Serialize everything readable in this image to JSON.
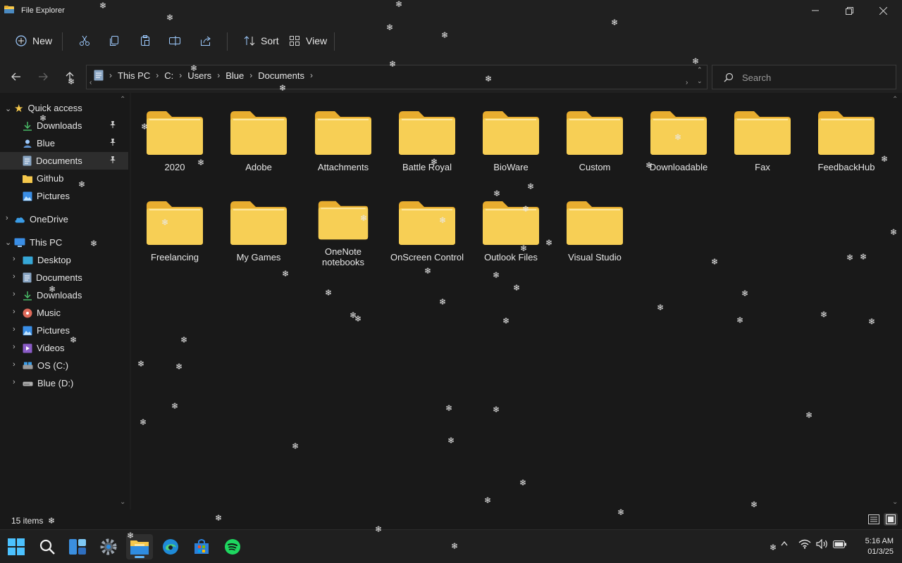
{
  "window": {
    "title": "File Explorer"
  },
  "toolbar": {
    "new_label": "New",
    "sort_label": "Sort",
    "view_label": "View"
  },
  "address": {
    "crumbs": [
      "This PC",
      "C:",
      "Users",
      "Blue",
      "Documents"
    ]
  },
  "search": {
    "placeholder": "Search"
  },
  "sidebar": {
    "quick_access": "Quick access",
    "qa_items": [
      "Downloads",
      "Blue",
      "Documents",
      "Github",
      "Pictures"
    ],
    "onedrive": "OneDrive",
    "this_pc": "This PC",
    "pc_items": [
      "Desktop",
      "Documents",
      "Downloads",
      "Music",
      "Pictures",
      "Videos",
      "OS (C:)",
      "Blue (D:)"
    ]
  },
  "folders": [
    "2020",
    "Adobe",
    "Attachments",
    "Battle Royal",
    "BioWare",
    "Custom",
    "Downloadable",
    "Fax",
    "FeedbackHub",
    "Freelancing",
    "My Games",
    "OneNote notebooks",
    "OnScreen Control",
    "Outlook Files",
    "Visual Studio"
  ],
  "status": {
    "item_count": "15 items"
  },
  "clock": {
    "time": "5:16 AM",
    "date": "01/3/25"
  },
  "colors": {
    "folder": "#f5c84c",
    "accent": "#60b8ff",
    "background": "#191919",
    "chrome": "#202020"
  },
  "icons": [
    "folder-icon",
    "star-icon",
    "pin-icon",
    "search-icon",
    "windows-start-icon",
    "edge-icon",
    "spotify-icon",
    "snowflake-icon"
  ]
}
